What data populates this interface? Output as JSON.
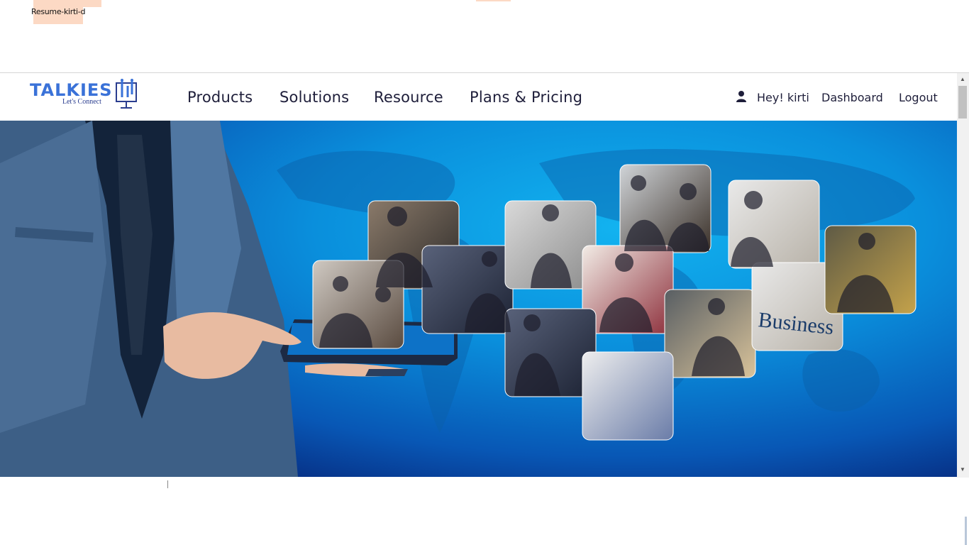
{
  "browser": {
    "tab_title": "Resume-kirti-d"
  },
  "logo": {
    "name": "TALKIES",
    "tagline": "Let's Connect"
  },
  "nav": {
    "items": [
      "Products",
      "Solutions",
      "Resource",
      "Plans & Pricing"
    ]
  },
  "user": {
    "greeting": "Hey! kirti",
    "dashboard": "Dashboard",
    "logout": "Logout",
    "icon": "user-icon"
  },
  "hero": {
    "description_icon": "hero-banner",
    "colors": {
      "light": "#12b3f0",
      "mid": "#0857b5",
      "dark": "#050c4f"
    }
  },
  "colors": {
    "brand_blue": "#3a72d8",
    "nav_text": "#1e1e3a"
  }
}
